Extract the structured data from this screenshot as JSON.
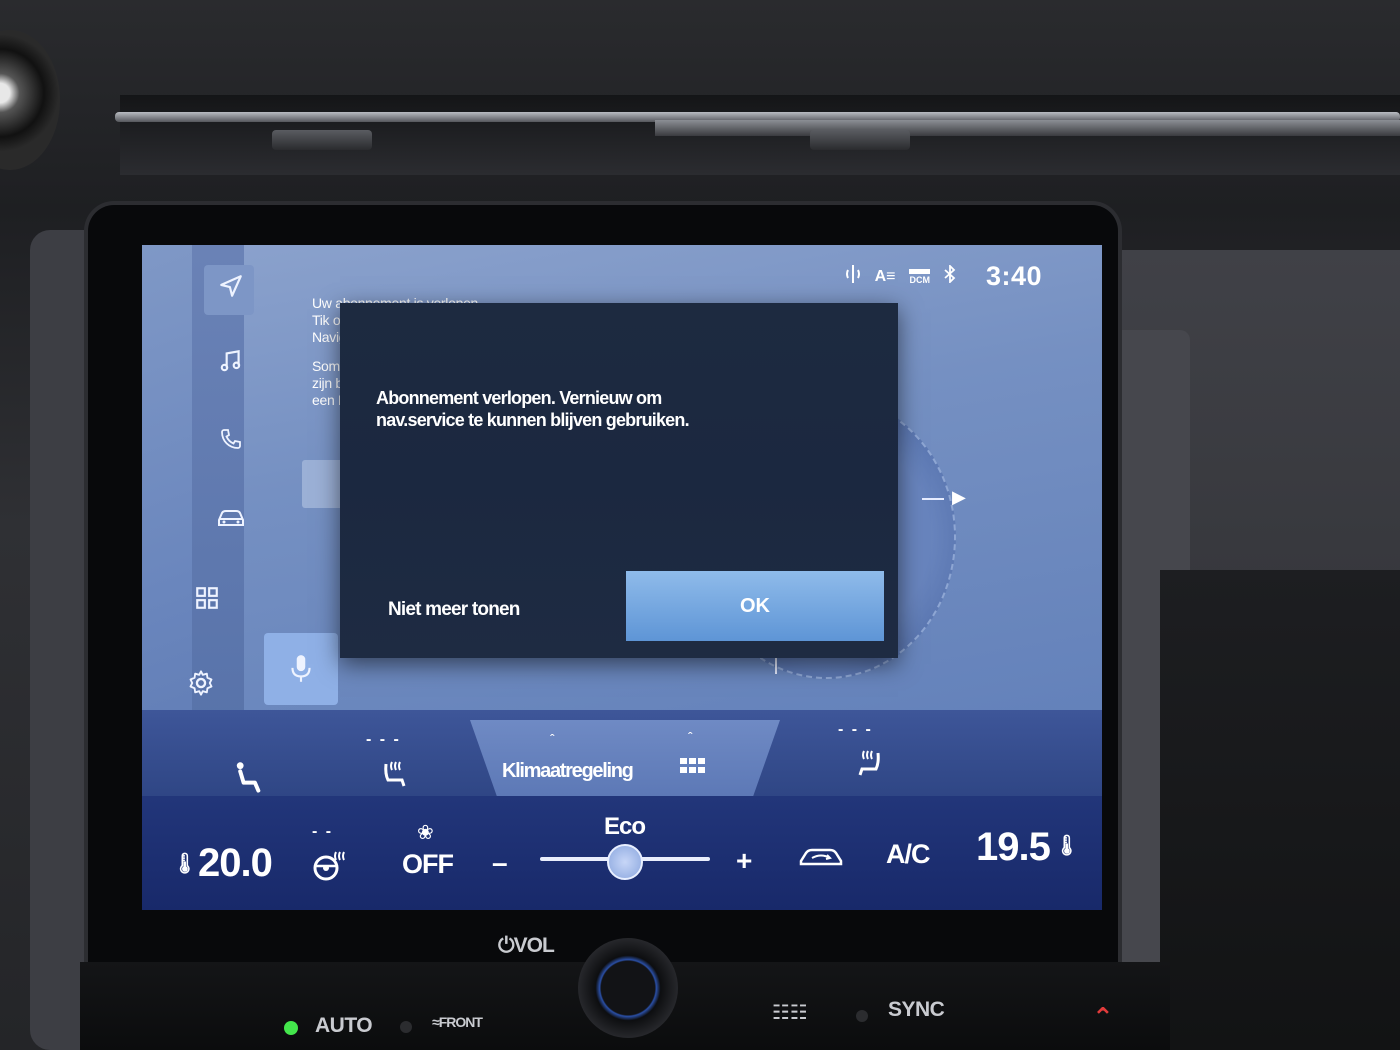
{
  "banner": {
    "line1": "Uw abonnement is verlopen.",
    "line2": "Tik op",
    "line3": "Naviga",
    "line4": "Somm",
    "line5": "zijn be",
    "line6": "een N"
  },
  "status": {
    "icons": [
      "wireless-charging-icon",
      "az-icon",
      "dcm-icon",
      "bluetooth-icon"
    ],
    "az_label": "A≡",
    "dcm_label": "DCM",
    "clock": "3:40"
  },
  "dialog": {
    "message": "Abonnement verlopen. Vernieuw om nav.service te kunnen blijven gebruiken.",
    "secondary_label": "Niet meer tonen",
    "ok_label": "OK"
  },
  "sidebar": {
    "items": [
      "navigation-icon",
      "music-icon",
      "phone-icon",
      "car-icon",
      "apps-icon",
      "settings-icon"
    ]
  },
  "climate_bar": {
    "tab_label": "Klimaatregeling",
    "seat_dashes_left": "- - -",
    "seat_dashes_right": "- - -"
  },
  "climate": {
    "left_temp": "20.0",
    "wheel_dashes": "- -",
    "fan_label": "OFF",
    "minus": "–",
    "plus": "+",
    "eco_label": "Eco",
    "ac_label": "A/C",
    "right_temp": "19.5"
  },
  "hardware": {
    "vol_label": "⏻VOL",
    "auto_label": "AUTO",
    "front_label": "FRONT",
    "sync_label": "SYNC"
  }
}
